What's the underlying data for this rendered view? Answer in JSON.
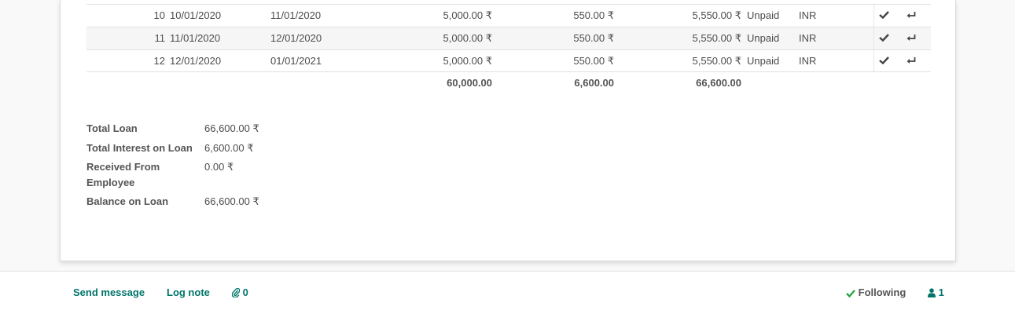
{
  "installments": [
    {
      "num": "10",
      "date_from": "10/01/2020",
      "date_to": "11/01/2020",
      "amount": "5,000.00 ₹",
      "interest": "550.00 ₹",
      "total": "5,550.00 ₹",
      "status": "Unpaid",
      "currency": "INR"
    },
    {
      "num": "11",
      "date_from": "11/01/2020",
      "date_to": "12/01/2020",
      "amount": "5,000.00 ₹",
      "interest": "550.00 ₹",
      "total": "5,550.00 ₹",
      "status": "Unpaid",
      "currency": "INR"
    },
    {
      "num": "12",
      "date_from": "12/01/2020",
      "date_to": "01/01/2021",
      "amount": "5,000.00 ₹",
      "interest": "550.00 ₹",
      "total": "5,550.00 ₹",
      "status": "Unpaid",
      "currency": "INR"
    }
  ],
  "totals": {
    "amount": "60,000.00",
    "interest": "6,600.00",
    "total": "66,600.00"
  },
  "summary": {
    "total_loan_label": "Total Loan",
    "total_loan_value": "66,600.00 ₹",
    "total_interest_label": "Total Interest on Loan",
    "total_interest_value": "6,600.00 ₹",
    "received_label_line1": "Received From",
    "received_label_line2": "Employee",
    "received_value": "0.00 ₹",
    "balance_label": "Balance on Loan",
    "balance_value": "66,600.00 ₹"
  },
  "chatter": {
    "send_message": "Send message",
    "log_note": "Log note",
    "attachments_count": "0",
    "following": "Following",
    "followers_count": "1"
  },
  "colors": {
    "accent": "#01756a",
    "success": "#28a745"
  },
  "icons": {
    "row_action_1": "check-icon",
    "row_action_2": "return-icon",
    "attachments": "paperclip-icon",
    "following": "check-icon",
    "followers": "user-icon"
  }
}
